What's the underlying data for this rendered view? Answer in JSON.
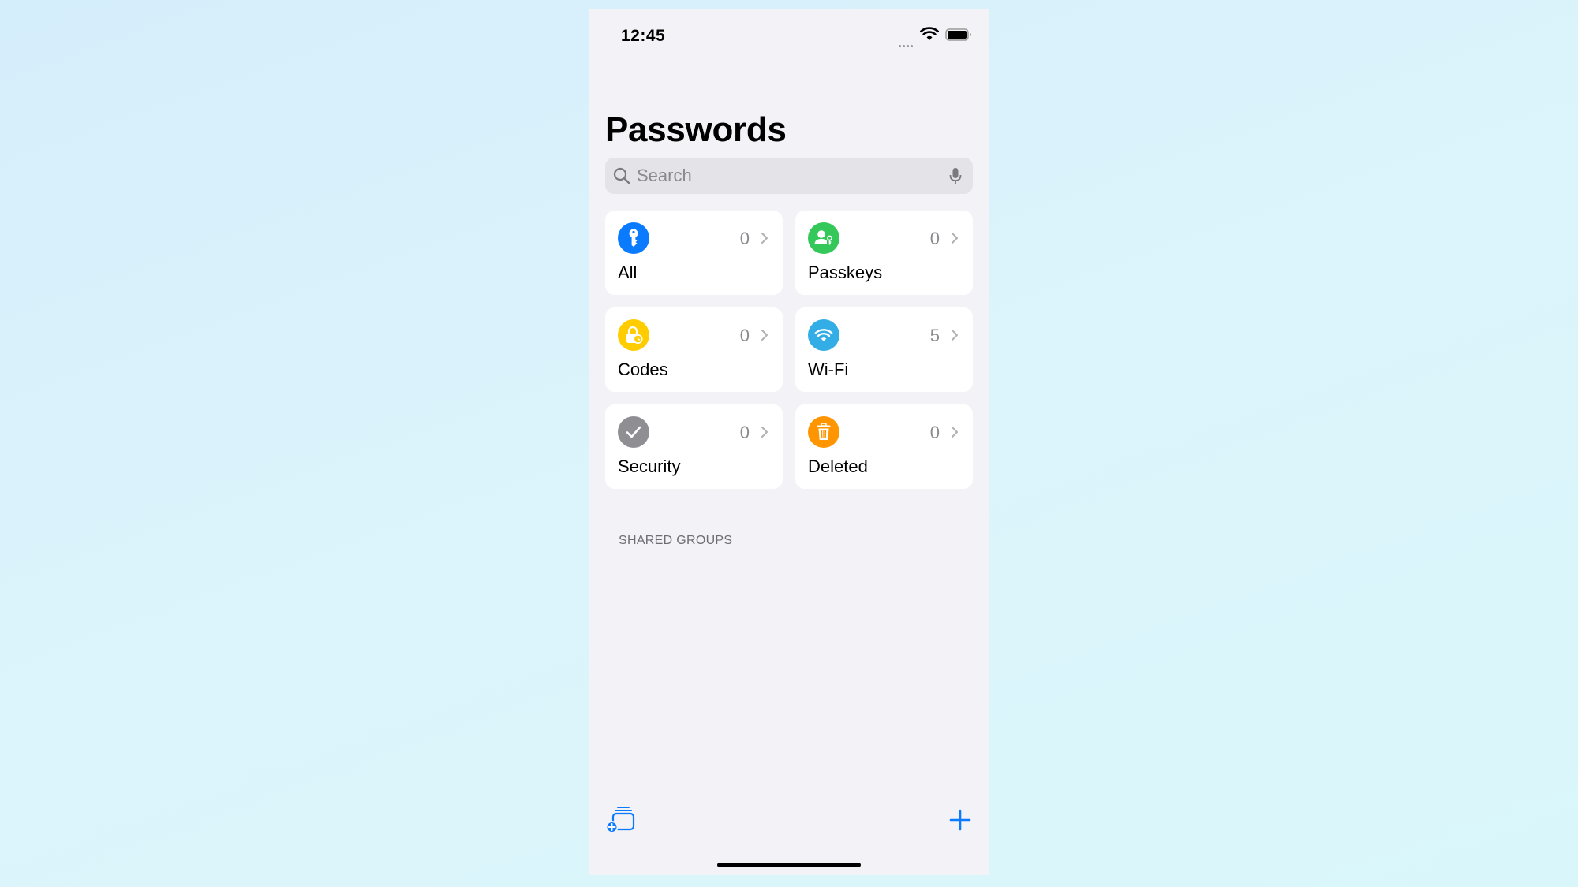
{
  "status_bar": {
    "time": "12:45"
  },
  "page": {
    "title": "Passwords"
  },
  "search": {
    "placeholder": "Search",
    "value": ""
  },
  "categories": [
    {
      "label": "All",
      "count": "0",
      "icon": "key-icon",
      "color": "#0a7aff"
    },
    {
      "label": "Passkeys",
      "count": "0",
      "icon": "person-key-icon",
      "color": "#34c759"
    },
    {
      "label": "Codes",
      "count": "0",
      "icon": "lock-clock-icon",
      "color": "#ffcc00"
    },
    {
      "label": "Wi-Fi",
      "count": "5",
      "icon": "wifi-icon",
      "color": "#32ade6"
    },
    {
      "label": "Security",
      "count": "0",
      "icon": "checkmark-icon",
      "color": "#8e8e93"
    },
    {
      "label": "Deleted",
      "count": "0",
      "icon": "trash-icon",
      "color": "#ff9500"
    }
  ],
  "sections": {
    "shared_groups_header": "SHARED GROUPS"
  },
  "toolbar": {
    "left_icon": "new-group-icon",
    "right_icon": "plus-icon",
    "accent": "#0a7aff"
  }
}
